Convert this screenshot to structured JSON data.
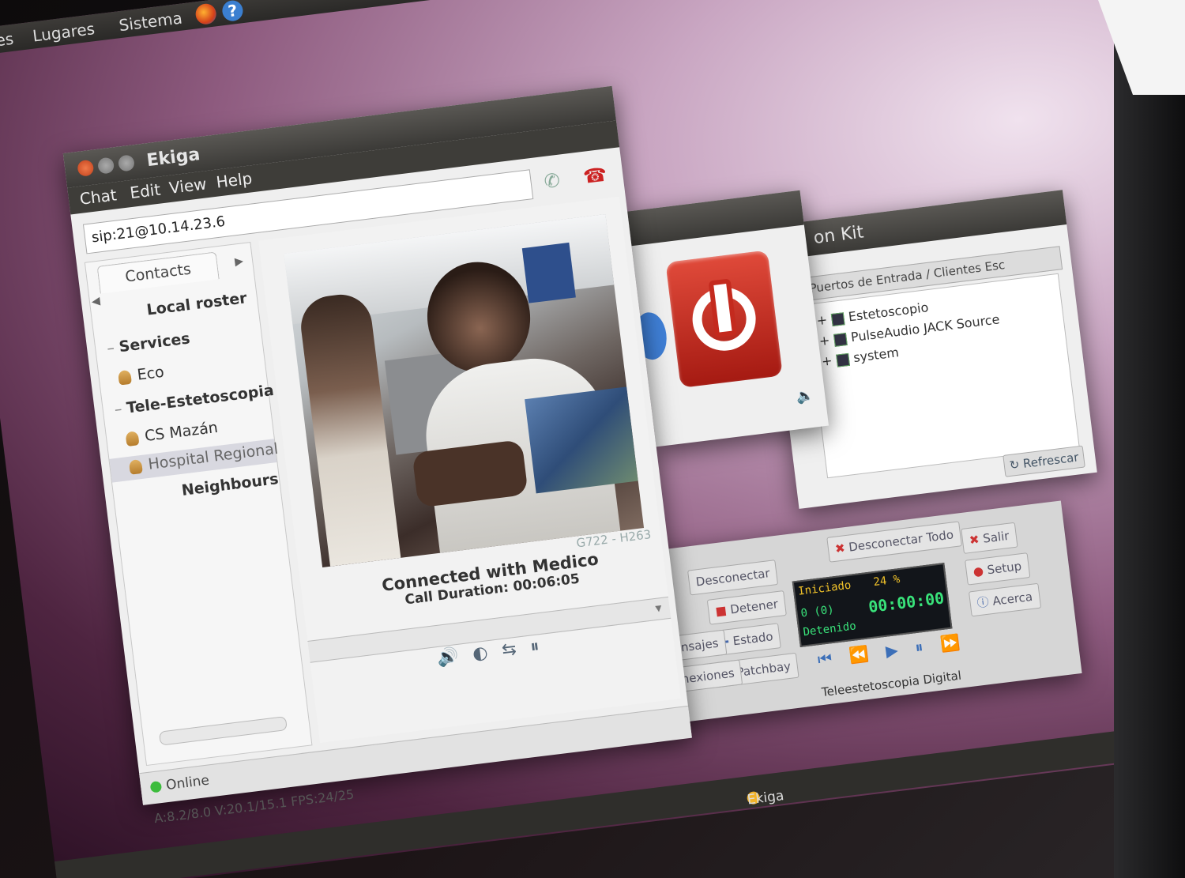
{
  "top_panel": {
    "items": [
      "nes",
      "Lugares",
      "Sistema"
    ]
  },
  "ekiga": {
    "title": "Ekiga",
    "menu": [
      "Chat",
      "Edit",
      "View",
      "Help"
    ],
    "uri_value": "sip:21@10.14.23.6",
    "contacts_tab": "Contacts",
    "roster": {
      "local_roster": "Local roster",
      "services": "Services",
      "eco": "Eco",
      "group_tele": "Tele-Estetoscopia",
      "cs_mazan": "CS Mazán",
      "hospital": "Hospital Regional",
      "neighbours": "Neighbours"
    },
    "status": {
      "connected": "Connected with Medico",
      "duration": "Call Duration: 00:06:05",
      "codec": "G722 - H263"
    },
    "statusbar": {
      "presence": "Online",
      "stats": "A:8.2/8.0   V:20.1/15.1   FPS:24/25"
    }
  },
  "jack": {
    "title": "on Kit",
    "dropdown": "Puertos de Entrada / Clientes Esc",
    "ports": [
      "Estetoscopio",
      "PulseAudio JACK Source",
      "system"
    ],
    "refresh": "Refrescar"
  },
  "transport": {
    "disconnect_all": "Desconectar Todo",
    "disconnect": "Desconectar",
    "stop": "Detener",
    "status": "Estado",
    "messages": "Mensajes",
    "patchbay": "Patchbay",
    "connections": "Conexiones",
    "quit": "Salir",
    "setup": "Setup",
    "about": "Acerca",
    "lcd_started": "Iniciado",
    "lcd_percent": "24 %",
    "lcd_time": "00:00:00",
    "lcd_zero": "0 (0)",
    "lcd_stopped": "Detenido",
    "window_label": "Teleestetoscopia Digital"
  },
  "taskbar": {
    "ekiga": "Ekiga"
  }
}
